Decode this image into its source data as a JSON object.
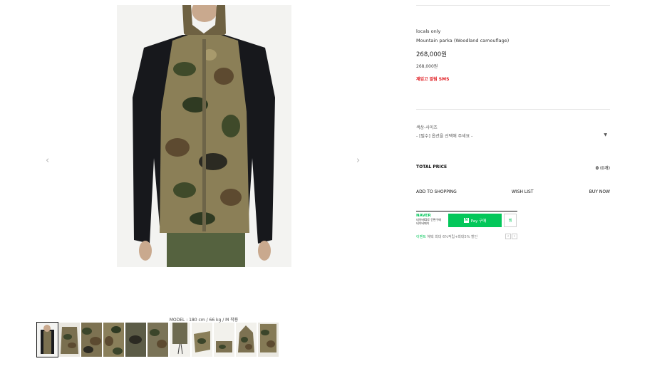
{
  "gallery": {
    "prev_label": "‹",
    "next_label": "›",
    "model_note": "MODEL : 180 cm / 66 kg / M 착용",
    "thumbnail_count": 11
  },
  "product": {
    "brand": "locals only",
    "name": "Mountain parka (Woodland camouflage)",
    "price": "268,000원",
    "price_sub": "268,000원",
    "restock_sms": "재입고 알림 SMS"
  },
  "option": {
    "label": "색상-사이즈",
    "placeholder": "- [필수] 옵션을 선택해 주세요 -",
    "caret": "▼"
  },
  "total": {
    "label": "TOTAL PRICE",
    "amount": "0",
    "count": "(0개)"
  },
  "actions": {
    "add_to_shopping": "ADD TO SHOPPING",
    "wish_list": "WISH LIST",
    "buy_now": "BUY NOW"
  },
  "npay": {
    "brand": "NAVER",
    "line1": "네이버ID로 간편구매",
    "line2": "네이버페이",
    "pay_label": "Pay 구매",
    "logo_letter": "N",
    "wish_label": "찜",
    "promo_green": "이벤트",
    "promo_text": "혜택 최대 6%적립+최대5% 할인",
    "nav_prev": "‹",
    "nav_next": "›"
  },
  "colors": {
    "accent_red": "#e0181e",
    "naver_green": "#03c75a"
  }
}
